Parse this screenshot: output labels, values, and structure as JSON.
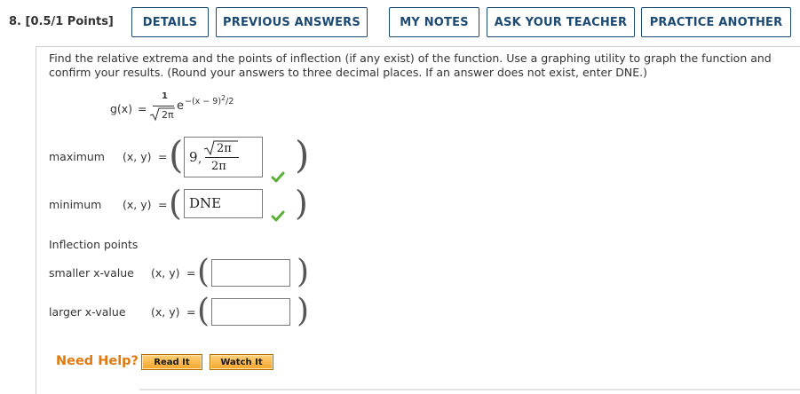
{
  "question": {
    "number_label": "8.",
    "points_label": "[0.5/1 Points]"
  },
  "toolbar": {
    "details": "DETAILS",
    "previous_answers": "PREVIOUS ANSWERS",
    "my_notes": "MY NOTES",
    "ask_teacher": "ASK YOUR TEACHER",
    "practice_another": "PRACTICE ANOTHER"
  },
  "prompt_text": "Find the relative extrema and the points of inflection (if any exist) of the function. Use a graphing utility to graph the function and confirm your results. (Round your answers to three decimal places. If an answer does not exist, enter DNE.)",
  "function": {
    "lhs": "g(x)",
    "equals": "=",
    "numerator": "1",
    "denominator": "2π",
    "base": "e",
    "exponent": "−(x − 9)",
    "exponent_power": "2",
    "exponent_tail": "/2"
  },
  "maximum": {
    "label": "maximum",
    "xy_label": "(x, y)",
    "equals": "=",
    "answer_x": "9",
    "comma": ",",
    "answer_y_num": "2π",
    "answer_y_den": "2π",
    "status": "correct"
  },
  "minimum": {
    "label": "minimum",
    "xy_label": "(x, y)",
    "equals": "=",
    "answer": "DNE",
    "status": "correct"
  },
  "inflection": {
    "heading": "Inflection points",
    "smaller": {
      "label": "smaller x-value",
      "xy_label": "(x, y)",
      "equals": "=",
      "value": ""
    },
    "larger": {
      "label": "larger x-value",
      "xy_label": "(x, y)",
      "equals": "=",
      "value": ""
    }
  },
  "help": {
    "label": "Need Help?",
    "read_it": "Read It",
    "watch_it": "Watch It"
  },
  "colors": {
    "button_border": "#1d4a72",
    "check": "#5cb03a",
    "help_text": "#e07a10",
    "help_button": "#f4a52a"
  },
  "icons": {
    "correct": "check-icon"
  }
}
